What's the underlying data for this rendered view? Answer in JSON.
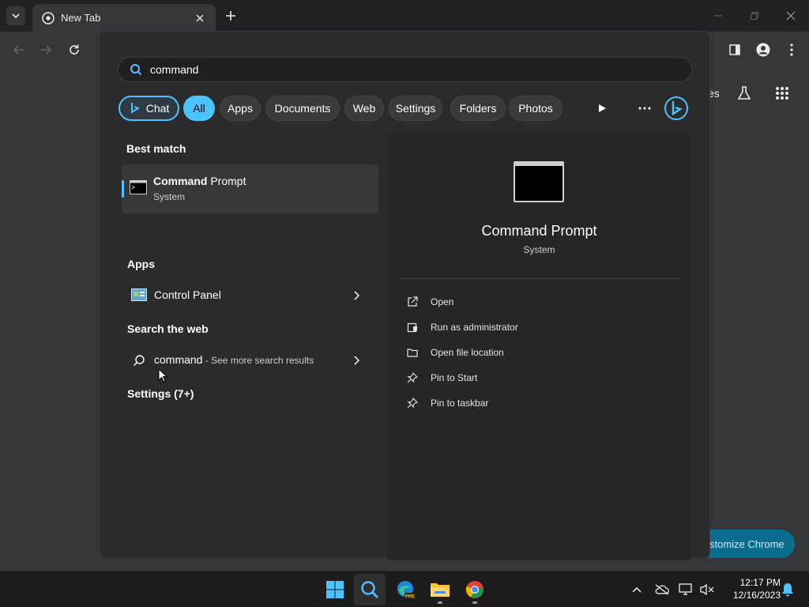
{
  "browser": {
    "tab_title": "New Tab",
    "ntp_partial_link": "es",
    "customize_label": "stomize Chrome"
  },
  "search": {
    "query": "command"
  },
  "filters": [
    {
      "label": "Chat"
    },
    {
      "label": "All"
    },
    {
      "label": "Apps"
    },
    {
      "label": "Documents"
    },
    {
      "label": "Web"
    },
    {
      "label": "Settings"
    },
    {
      "label": "Folders"
    },
    {
      "label": "Photos"
    }
  ],
  "results": {
    "best_match_heading": "Best match",
    "best_match": {
      "title_bold": "Command",
      "title_rest": " Prompt",
      "subtitle": "System"
    },
    "apps_heading": "Apps",
    "apps": [
      {
        "title": "Control Panel"
      }
    ],
    "web_heading": "Search the web",
    "web": {
      "query": "command",
      "suffix": " - See more search results"
    },
    "settings_heading": "Settings (7+)"
  },
  "preview": {
    "title": "Command Prompt",
    "subtitle": "System",
    "actions": [
      {
        "label": "Open",
        "icon": "open-external-icon"
      },
      {
        "label": "Run as administrator",
        "icon": "shield-admin-icon"
      },
      {
        "label": "Open file location",
        "icon": "folder-icon"
      },
      {
        "label": "Pin to Start",
        "icon": "pin-icon"
      },
      {
        "label": "Pin to taskbar",
        "icon": "pin-icon"
      }
    ]
  },
  "taskbar": {
    "time": "12:17 PM",
    "date": "12/16/2023",
    "edge_badge": "PRE"
  },
  "colors": {
    "accent": "#4cc2ff",
    "flyout_bg": "#2b2b2b",
    "taskbar_bg": "#1c1c1c"
  }
}
